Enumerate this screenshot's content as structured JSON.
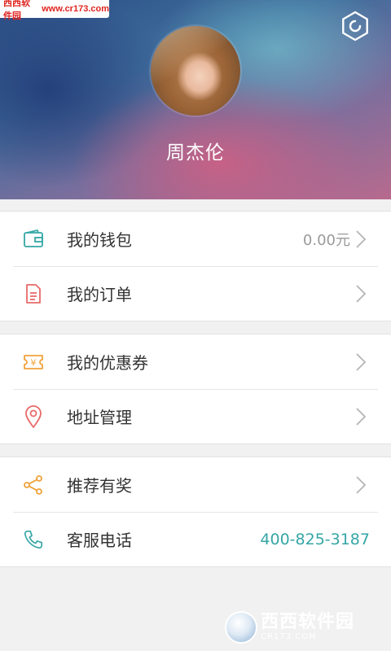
{
  "watermark": {
    "top_name": "西西软件园",
    "top_url": "www.cr173.com",
    "bottom_brand": "西西软件园",
    "bottom_site": "CR173.COM"
  },
  "profile": {
    "username": "周杰伦"
  },
  "menu": {
    "wallet": {
      "label": "我的钱包",
      "value": "0.00元"
    },
    "orders": {
      "label": "我的订单"
    },
    "coupons": {
      "label": "我的优惠券"
    },
    "address": {
      "label": "地址管理"
    },
    "referral": {
      "label": "推荐有奖"
    },
    "service": {
      "label": "客服电话",
      "value": "400-825-3187"
    }
  },
  "icons": {
    "settings": "gear-icon",
    "wallet": "wallet-icon",
    "orders": "document-icon",
    "coupons": "ticket-icon",
    "address": "location-pin-icon",
    "referral": "share-icon",
    "service": "phone-icon",
    "chevron": "chevron-right-icon"
  },
  "colors": {
    "teal": "#35a6a6",
    "red": "#e86a6a",
    "orange": "#f0a23a",
    "text": "#333333",
    "muted": "#9a9a9a"
  }
}
